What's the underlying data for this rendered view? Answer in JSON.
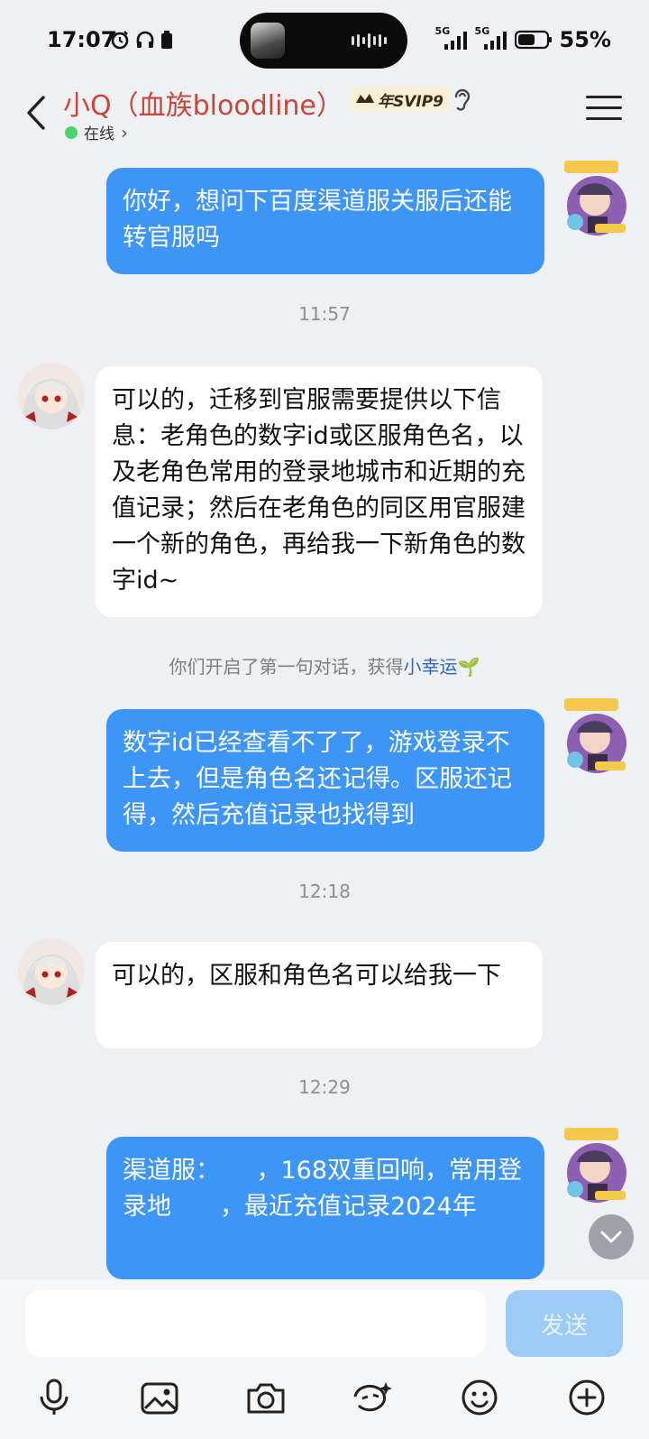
{
  "status_bar": {
    "time": "17:07",
    "network_1": "5G",
    "network_2": "5G",
    "battery": "55%"
  },
  "header": {
    "title": "小Q（血族bloodline）",
    "vip_badge": "年SVIP9",
    "online_status": "在线",
    "online_chevron": "›"
  },
  "messages": [
    {
      "direction": "out",
      "text": "你好，想问下百度渠道服关服后还能转官服吗"
    },
    {
      "type": "time",
      "text": "11:57"
    },
    {
      "direction": "in",
      "text": "可以的，迁移到官服需要提供以下信息：老角色的数字id或区服角色名，以及老角色常用的登录地城市和近期的充值记录；然后在老角色的同区用官服建一个新的角色，再给我一下新角色的数字id~"
    },
    {
      "type": "system",
      "text": "你们开启了第一句对话，获得",
      "link": "小幸运",
      "emoji": "🌱"
    },
    {
      "direction": "out",
      "text": "数字id已经查看不了了，游戏登录不上去，但是角色名还记得。区服还记得，然后充值记录也找得到"
    },
    {
      "type": "time",
      "text": "12:18"
    },
    {
      "direction": "in",
      "text": "可以的，区服和角色名可以给我一下"
    },
    {
      "type": "time",
      "text": "12:29"
    },
    {
      "direction": "out",
      "text": "渠道服：　　，168双重回响，常用登录地　　，最近充值记录2024年　　　　　　"
    }
  ],
  "input": {
    "placeholder": "",
    "send_label": "发送"
  },
  "toolbar_icons": [
    "microphone-icon",
    "image-icon",
    "camera-icon",
    "sticker-icon",
    "emoji-icon",
    "plus-icon"
  ],
  "colors": {
    "outgoing_bubble": "#3d95f6",
    "incoming_bubble": "#ffffff",
    "title": "#c9463a",
    "online": "#4cd26a",
    "send_disabled": "#9ccbf6"
  }
}
